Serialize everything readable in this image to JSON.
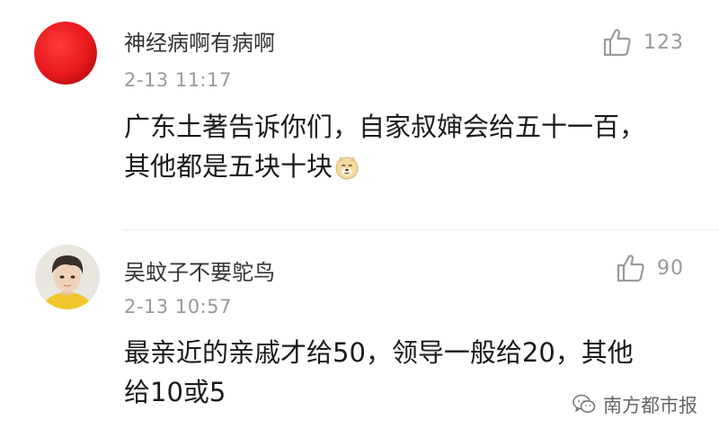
{
  "comments": [
    {
      "username": "神经病啊有病啊",
      "timestamp": "2-13 11:17",
      "likes": "123",
      "avatar_icon": "red-circle-avatar",
      "text_lines": [
        "广东土著告诉你们，自家叔婶会给五十一百，",
        "其他都是五块十块"
      ],
      "emoji": "doge-emoji"
    },
    {
      "username": "吴蚊子不要鸵鸟",
      "timestamp": "2-13 10:57",
      "likes": "90",
      "avatar_icon": "boy-portrait-avatar",
      "text_lines": [
        "最亲近的亲戚才给50，领导一般给20，其他",
        "给10或5"
      ]
    }
  ],
  "watermark": {
    "label": "南方都市报",
    "icon": "wechat-icon"
  },
  "colors": {
    "avatar_red": "#e8191c",
    "meta_gray": "#999999",
    "text": "#1a1a1a"
  }
}
